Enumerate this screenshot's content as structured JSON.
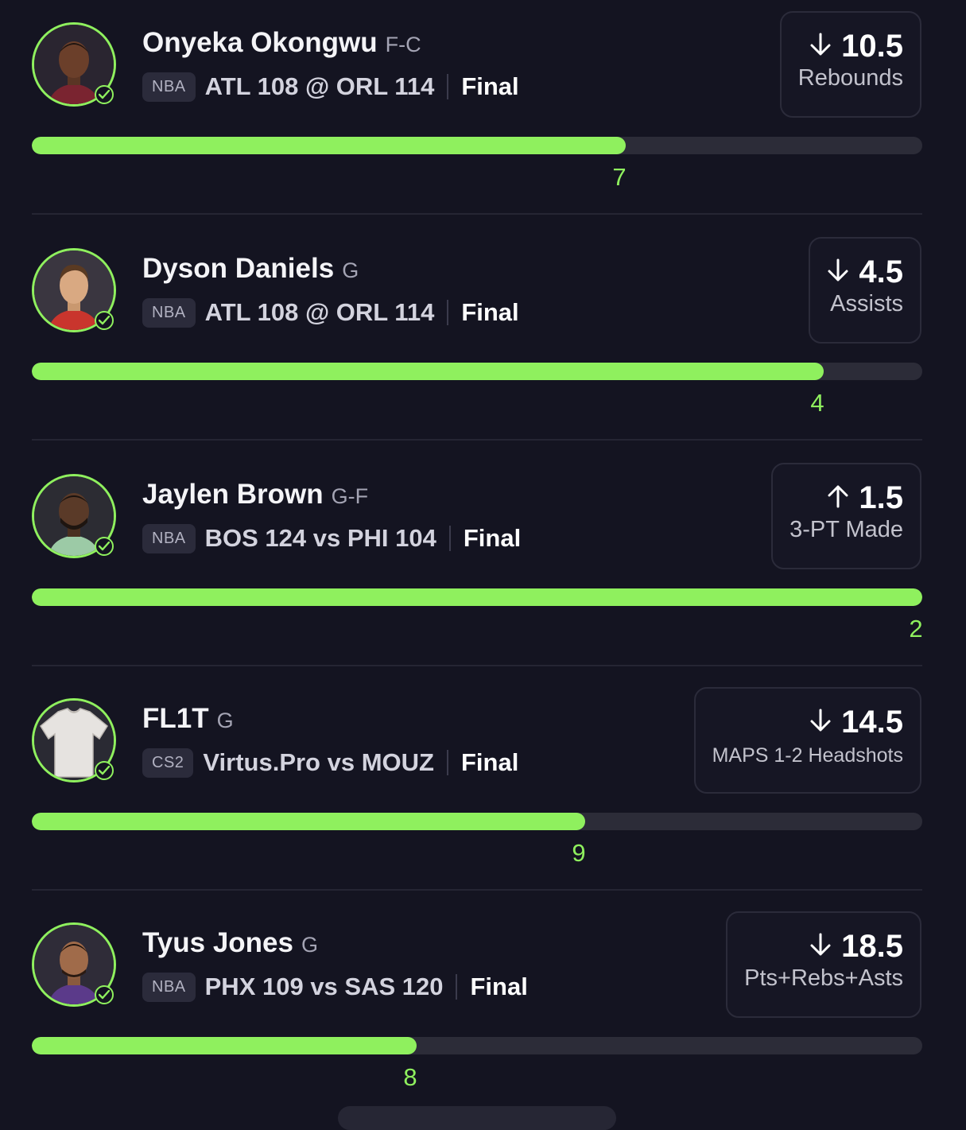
{
  "colors": {
    "background": "#141421",
    "accent": "#8ff05e",
    "track": "#2c2c38"
  },
  "picks": [
    {
      "player": "Onyeka Okongwu",
      "position": "F-C",
      "league": "NBA",
      "matchup": "ATL 108 @ ORL 114",
      "status": "Final",
      "direction_icon": "arrow-down-icon",
      "line": "10.5",
      "stat": "Rebounds",
      "actual": "7",
      "progress_fraction": 0.667
    },
    {
      "player": "Dyson Daniels",
      "position": "G",
      "league": "NBA",
      "matchup": "ATL 108 @ ORL 114",
      "status": "Final",
      "direction_icon": "arrow-down-icon",
      "line": "4.5",
      "stat": "Assists",
      "actual": "4",
      "progress_fraction": 0.889
    },
    {
      "player": "Jaylen Brown",
      "position": "G-F",
      "league": "NBA",
      "matchup": "BOS 124 vs PHI 104",
      "status": "Final",
      "direction_icon": "arrow-up-icon",
      "line": "1.5",
      "stat": "3-PT Made",
      "actual": "2",
      "progress_fraction": 1.0
    },
    {
      "player": "FL1T",
      "position": "G",
      "league": "CS2",
      "matchup": "Virtus.Pro vs MOUZ",
      "status": "Final",
      "direction_icon": "arrow-down-icon",
      "line": "14.5",
      "stat": "MAPS 1-2 Headshots",
      "actual": "9",
      "progress_fraction": 0.621
    },
    {
      "player": "Tyus Jones",
      "position": "G",
      "league": "NBA",
      "matchup": "PHX 109 vs SAS 120",
      "status": "Final",
      "direction_icon": "arrow-down-icon",
      "line": "18.5",
      "stat": "Pts+Rebs+Asts",
      "actual": "8",
      "progress_fraction": 0.432
    }
  ]
}
